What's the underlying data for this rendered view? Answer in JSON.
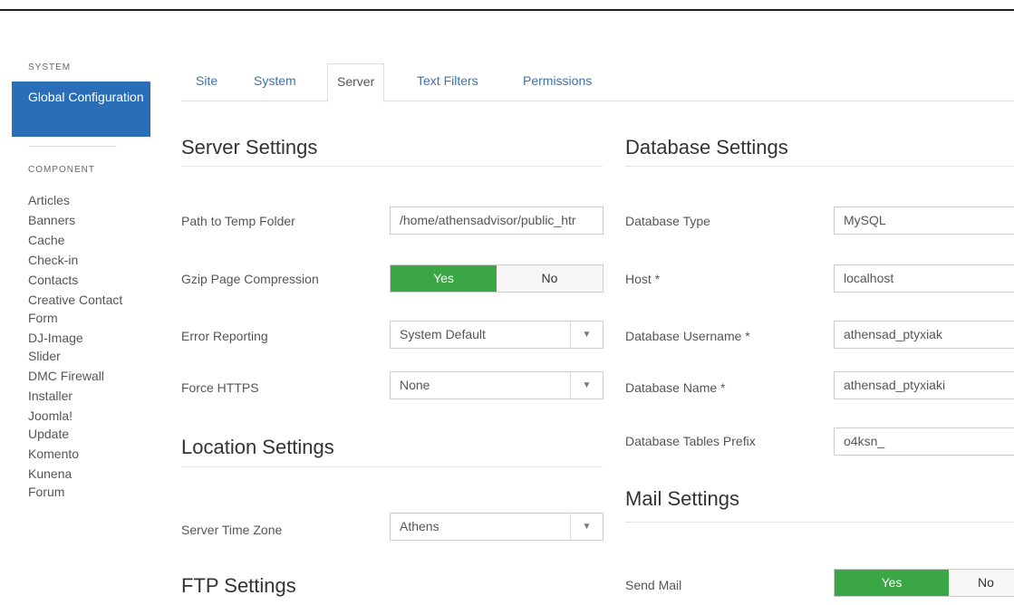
{
  "sidebar": {
    "system_header": "SYSTEM",
    "active_item": "Global Configuration",
    "component_header": "COMPONENT",
    "items": [
      "Articles",
      "Banners",
      "Cache",
      "Check-in",
      "Contacts",
      "Creative Contact Form",
      "DJ-ImageSlider",
      "DMC Firewall",
      "Installer",
      "Joomla! Update",
      "Komento",
      "Kunena Forum"
    ]
  },
  "tabs": [
    "Site",
    "System",
    "Server",
    "Text Filters",
    "Permissions"
  ],
  "active_tab": "Server",
  "server": {
    "title": "Server Settings",
    "temp_label": "Path to Temp Folder",
    "temp_value": "/home/athensadvisor/public_htr",
    "gzip_label": "Gzip Page Compression",
    "gzip_yes": "Yes",
    "gzip_no": "No",
    "error_label": "Error Reporting",
    "error_value": "System Default",
    "https_label": "Force HTTPS",
    "https_value": "None"
  },
  "location": {
    "title": "Location Settings",
    "tz_label": "Server Time Zone",
    "tz_value": "Athens"
  },
  "ftp": {
    "title": "FTP Settings"
  },
  "database": {
    "title": "Database Settings",
    "type_label": "Database Type",
    "type_value": "MySQL",
    "host_label": "Host *",
    "host_value": "localhost",
    "user_label": "Database Username *",
    "user_value": "athensad_ptyxiak",
    "name_label": "Database Name *",
    "name_value": "athensad_ptyxiaki",
    "prefix_label": "Database Tables Prefix",
    "prefix_value": "o4ksn_"
  },
  "mail": {
    "title": "Mail Settings",
    "send_label": "Send Mail",
    "send_yes": "Yes",
    "send_no": "No"
  },
  "colors": {
    "accent": "#2a6eb8",
    "toggle_on": "#3aa645",
    "link": "#3a73ad"
  },
  "icons": {
    "caret": "chevron-down-icon"
  }
}
